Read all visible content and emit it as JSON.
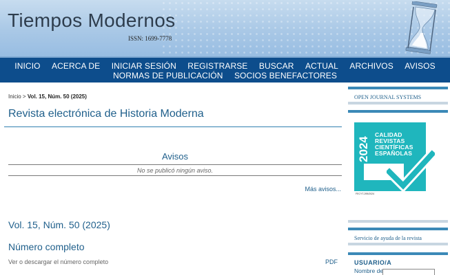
{
  "header": {
    "title": "Tiempos Modernos",
    "issn": "ISSN: 1699-7778"
  },
  "nav": {
    "items": [
      "INICIO",
      "ACERCA DE",
      "INICIAR SESIÓN",
      "REGISTRARSE",
      "BUSCAR",
      "ACTUAL",
      "ARCHIVOS",
      "AVISOS",
      "NORMAS DE PUBLICACIÓN",
      "SOCIOS BENEFACTORES"
    ]
  },
  "breadcrumb": {
    "home": "Inicio",
    "separator": " > ",
    "current": "Vol. 15, Núm. 50 (2025)"
  },
  "main": {
    "journal_title": "Revista electrónica de Historia Moderna",
    "avisos_title": "Avisos",
    "no_avisos": "No se publicó ningún aviso.",
    "mas_avisos": "Más avisos...",
    "issue_title": "Vol. 15, Núm. 50 (2025)",
    "numero_completo": "Número completo",
    "ver_descargar": "Ver o descargar el número completo",
    "pdf": "PDF"
  },
  "sidebar": {
    "ojs": "OPEN JOURNAL SYSTEMS",
    "badge_year": "2024",
    "badge_text": "CALIDAD\nREVISTAS\nCIENTÍFICAS\nESPAÑOLAS",
    "badge_caption": "FECYT-295/2024",
    "ayuda": "Servicio de ayuda de la revista",
    "usuario_title": "USUARIO/A",
    "usuario_field": "Nombre de usuario/a"
  },
  "colors": {
    "nav_bg": "#0d4d8c",
    "link": "#1f5f8b",
    "badge": "#1fb6bd"
  }
}
